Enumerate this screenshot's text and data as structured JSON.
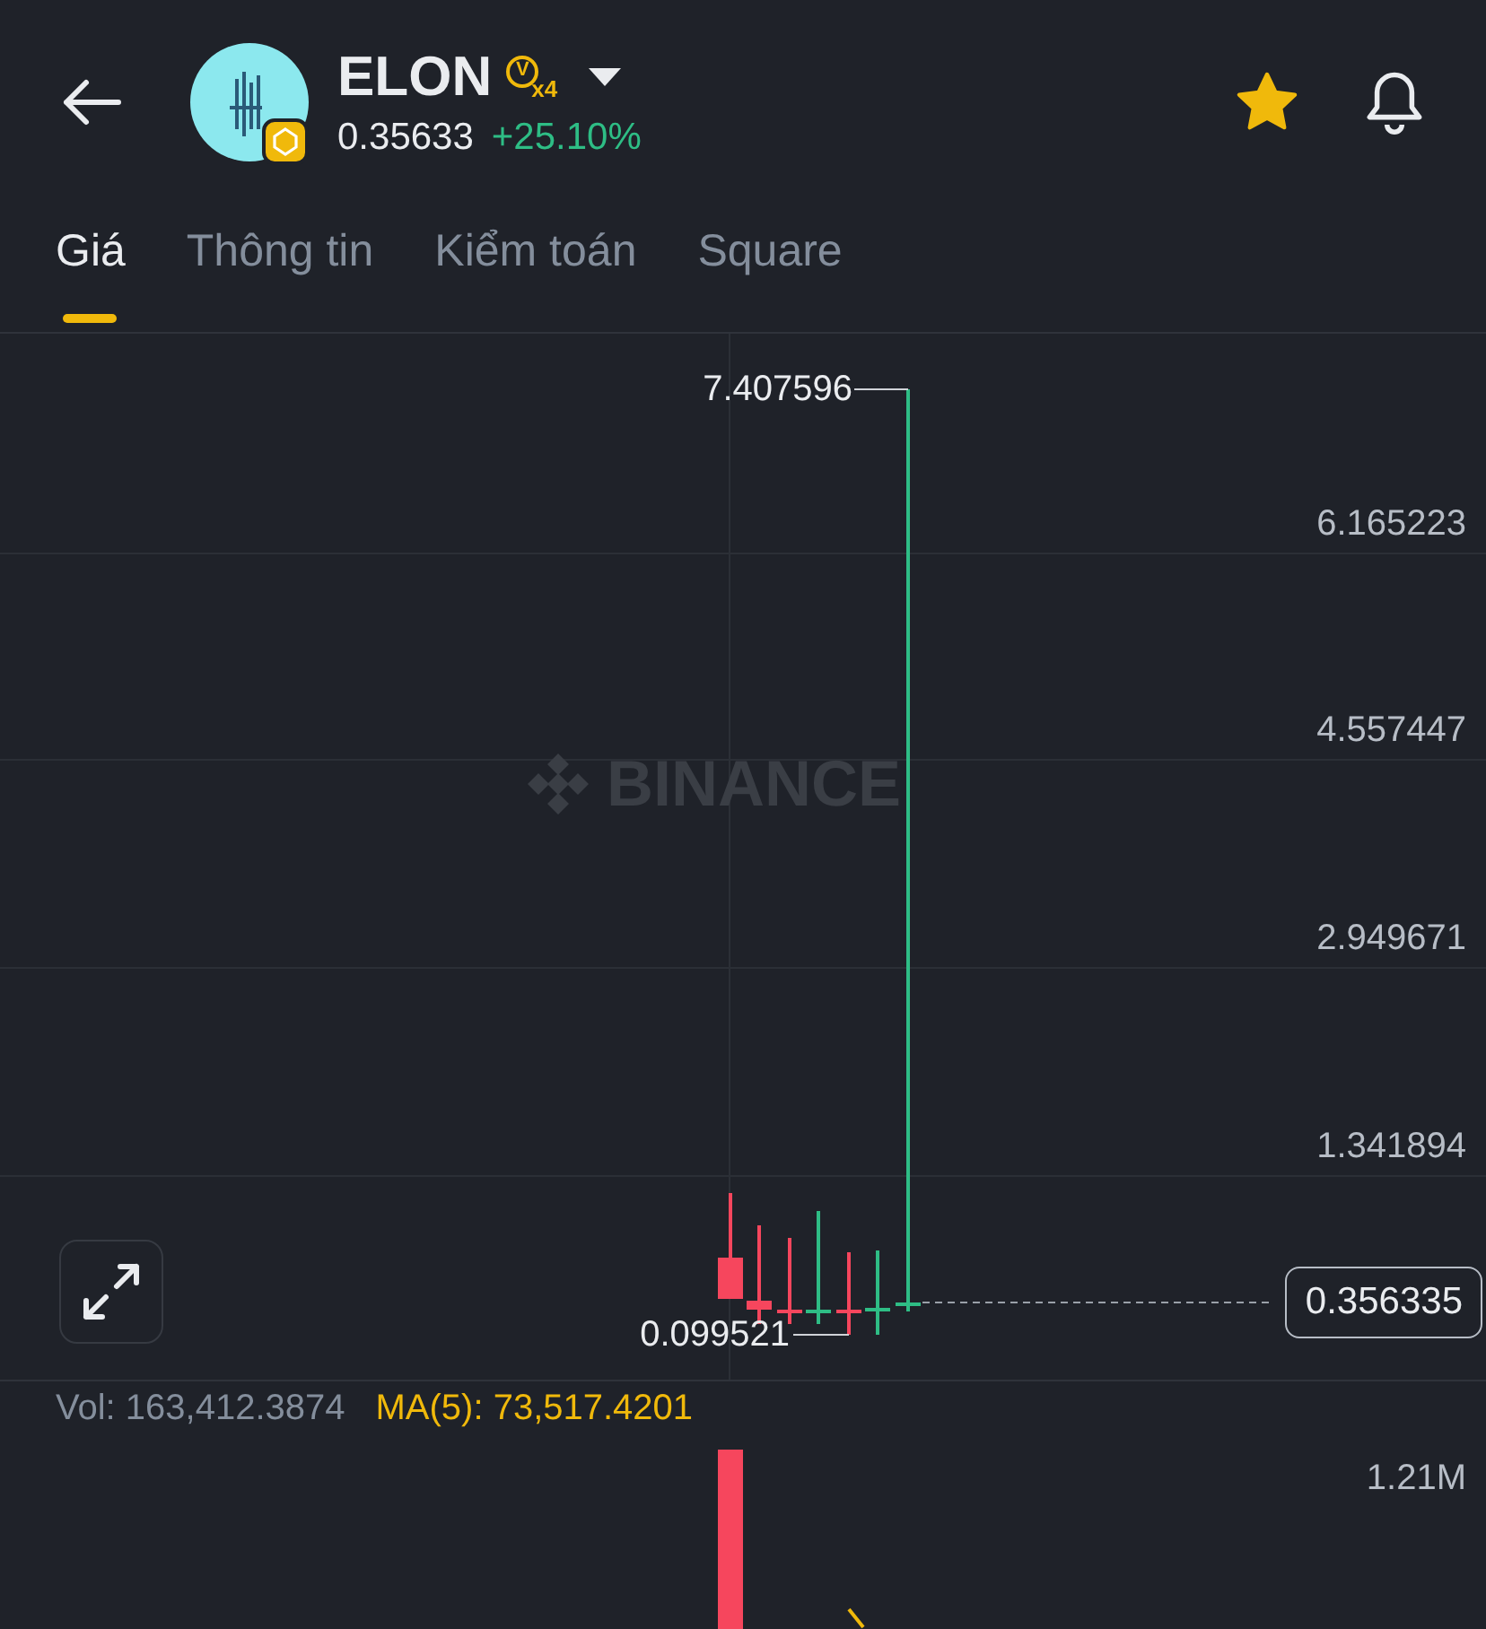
{
  "header": {
    "symbol": "ELON",
    "badge_letter": "V",
    "badge_multiplier": "x4",
    "price": "0.35633",
    "change": "+25.10%",
    "favorite": true
  },
  "tabs": [
    {
      "label": "Giá",
      "selected": true
    },
    {
      "label": "Thông tin",
      "selected": false
    },
    {
      "label": "Kiểm toán",
      "selected": false
    },
    {
      "label": "Square",
      "selected": false
    }
  ],
  "chart": {
    "watermark": "BINANCE",
    "y_labels": [
      "6.165223",
      "4.557447",
      "2.949671",
      "1.341894"
    ],
    "high_label": "7.407596",
    "low_label": "0.099521",
    "last_price": "0.356335"
  },
  "volume": {
    "vol": "Vol: 163,412.3874",
    "ma": "MA(5): 73,517.4201",
    "axis_label": "1.21M"
  }
}
